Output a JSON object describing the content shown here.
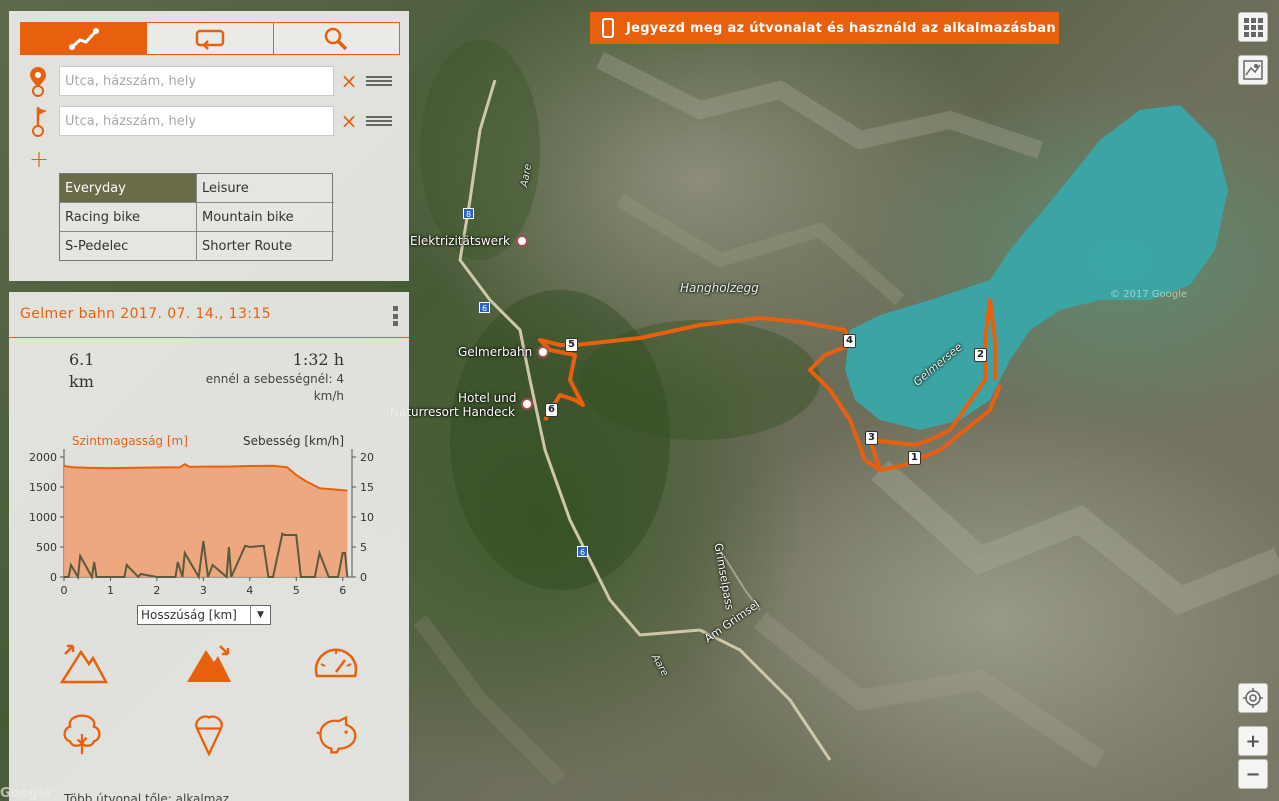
{
  "banner": {
    "text": "Jegyezd meg az útvonalat és használd az alkalmazásban"
  },
  "tabs": [
    {
      "name": "route-tab",
      "icon": "route-icon"
    },
    {
      "name": "roundtrip-tab",
      "icon": "loop-icon"
    },
    {
      "name": "search-tab",
      "icon": "search-icon"
    }
  ],
  "waypoints": {
    "start_placeholder": "Utca, házszám, hely",
    "end_placeholder": "Utca, házszám, hely",
    "clear_glyph": "×",
    "add_glyph": "+"
  },
  "profiles": [
    "Everyday",
    "Leisure",
    "Racing bike",
    "Mountain bike",
    "S-Pedelec",
    "Shorter Route"
  ],
  "profile_selected": "Everyday",
  "trip": {
    "title": "Gelmer bahn 2017. 07. 14., 13:15",
    "distance": "6.1",
    "distance_unit": "km",
    "duration": "1:32 h",
    "speed_note": "ennél a sebességnél: 4 km/h",
    "axis_select": "Hosszúság [km]",
    "more_routes": "Több útvonal tőle: alkalmaz..."
  },
  "chart_data": {
    "type": "area",
    "left_axis_label": "Szintmagasság [m]",
    "right_axis_label": "Sebesség [km/h]",
    "xlabel": "Hosszúság [km]",
    "xlim": [
      0,
      6.2
    ],
    "ylim_left": [
      0,
      2000
    ],
    "ylim_right": [
      0,
      20
    ],
    "x_ticks": [
      0,
      1,
      2,
      3,
      4,
      5,
      6
    ],
    "y_ticks_left": [
      0,
      500,
      1000,
      1500,
      2000
    ],
    "y_ticks_right": [
      0,
      5,
      10,
      15,
      20
    ],
    "series": [
      {
        "name": "Szintmagasság [m]",
        "x": [
          0,
          0.2,
          0.5,
          1.0,
          1.5,
          2.0,
          2.5,
          2.6,
          2.7,
          3.0,
          3.5,
          4.0,
          4.5,
          4.8,
          5.0,
          5.2,
          5.5,
          5.8,
          6.1
        ],
        "y": [
          1850,
          1830,
          1820,
          1815,
          1820,
          1825,
          1830,
          1880,
          1835,
          1840,
          1840,
          1850,
          1855,
          1830,
          1700,
          1600,
          1480,
          1460,
          1440
        ]
      },
      {
        "name": "Sebesség [km/h]",
        "x": [
          0,
          0.1,
          0.15,
          0.3,
          0.35,
          0.6,
          0.65,
          0.7,
          1.0,
          1.3,
          1.35,
          1.6,
          1.65,
          2.0,
          2.4,
          2.45,
          2.55,
          2.6,
          2.9,
          3.0,
          3.1,
          3.2,
          3.5,
          3.55,
          3.6,
          3.9,
          4.0,
          4.3,
          4.4,
          4.5,
          4.7,
          4.75,
          5.0,
          5.1,
          5.4,
          5.5,
          5.7,
          5.9,
          6.0,
          6.05,
          6.1
        ],
        "y": [
          0,
          0,
          2,
          0,
          3.5,
          0,
          2.5,
          0,
          0,
          0,
          2,
          0,
          0.5,
          0,
          0,
          2.5,
          0,
          4,
          0,
          6,
          0,
          2,
          0,
          5,
          0,
          5.2,
          5,
          5.2,
          0,
          0,
          7.2,
          7,
          7,
          0,
          0,
          4,
          0,
          0,
          4,
          4,
          0
        ]
      }
    ]
  },
  "map": {
    "labels": {
      "elektrizitatswerk": "Elektrizitätswerk",
      "gelmerbahn": "Gelmerbahn",
      "hotel_1": "Hotel und",
      "hotel_2": "Naturresort Handeck",
      "hangholzegg": "Hangholzegg",
      "gelmersee": "Gelmersee",
      "aare_1": "Aare",
      "aare_2": "Aare",
      "grimselpass_1": "Grimselpass",
      "grimselpass_2": "Am Grimsel",
      "copyright": "© 2017 Google",
      "google": "Google"
    },
    "road_shields": [
      "8",
      "6",
      "6"
    ],
    "waypoint_markers": [
      "1",
      "2",
      "3",
      "4",
      "5",
      "6"
    ],
    "route_color": "#e8600e",
    "lake_color": "#3aa6a8"
  },
  "controls": {
    "grid_icon": "apps-grid-icon",
    "map_layers_icon": "map-layers-icon",
    "locate_icon": "locate-icon",
    "zoom_in": "+",
    "zoom_out": "−"
  },
  "colors": {
    "accent": "#e8600e",
    "selected_profile": "#6b6b4a"
  }
}
